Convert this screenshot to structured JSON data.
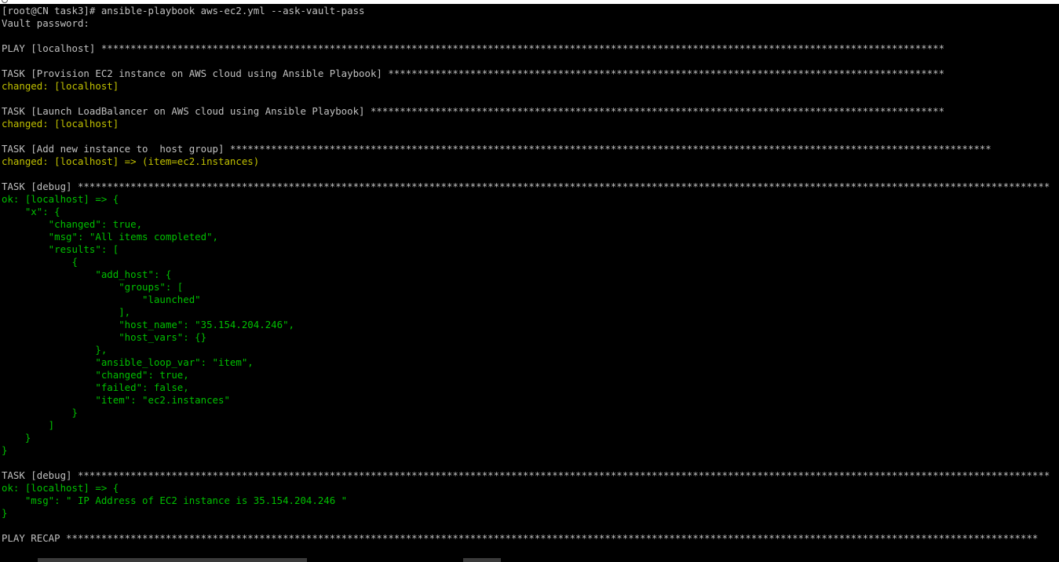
{
  "terminal": {
    "colors": {
      "background": "#000000",
      "default_text": "#c0c0c0",
      "changed": "#c0c000",
      "ok": "#00c000"
    },
    "lines": [
      {
        "text": "[root@CN task3]# ansible-playbook aws-ec2.yml --ask-vault-pass",
        "style": "default"
      },
      {
        "text": "Vault password:",
        "style": "default"
      },
      {
        "text": "",
        "style": "default"
      },
      {
        "text": "PLAY [localhost] ************************************************************************************************************************************************",
        "style": "default"
      },
      {
        "text": "",
        "style": "default"
      },
      {
        "text": "TASK [Provision EC2 instance on AWS cloud using Ansible Playbook] ***********************************************************************************************",
        "style": "default"
      },
      {
        "text": "changed: [localhost]",
        "style": "changed"
      },
      {
        "text": "",
        "style": "default"
      },
      {
        "text": "TASK [Launch LoadBalancer on AWS cloud using Ansible Playbook] **************************************************************************************************",
        "style": "default"
      },
      {
        "text": "changed: [localhost]",
        "style": "changed"
      },
      {
        "text": "",
        "style": "default"
      },
      {
        "text": "TASK [Add new instance to  host group] **********************************************************************************************************************************",
        "style": "default"
      },
      {
        "text": "changed: [localhost] => (item=ec2.instances)",
        "style": "changed"
      },
      {
        "text": "",
        "style": "default"
      },
      {
        "text": "TASK [debug] **********************************************************************************************************************************************************************",
        "style": "default"
      },
      {
        "text": "ok: [localhost] => {",
        "style": "ok"
      },
      {
        "text": "    \"x\": {",
        "style": "ok"
      },
      {
        "text": "        \"changed\": true,",
        "style": "ok"
      },
      {
        "text": "        \"msg\": \"All items completed\",",
        "style": "ok"
      },
      {
        "text": "        \"results\": [",
        "style": "ok"
      },
      {
        "text": "            {",
        "style": "ok"
      },
      {
        "text": "                \"add_host\": {",
        "style": "ok"
      },
      {
        "text": "                    \"groups\": [",
        "style": "ok"
      },
      {
        "text": "                        \"launched\"",
        "style": "ok"
      },
      {
        "text": "                    ],",
        "style": "ok"
      },
      {
        "text": "                    \"host_name\": \"35.154.204.246\",",
        "style": "ok"
      },
      {
        "text": "                    \"host_vars\": {}",
        "style": "ok"
      },
      {
        "text": "                },",
        "style": "ok"
      },
      {
        "text": "                \"ansible_loop_var\": \"item\",",
        "style": "ok"
      },
      {
        "text": "                \"changed\": true,",
        "style": "ok"
      },
      {
        "text": "                \"failed\": false,",
        "style": "ok"
      },
      {
        "text": "                \"item\": \"ec2.instances\"",
        "style": "ok"
      },
      {
        "text": "            }",
        "style": "ok"
      },
      {
        "text": "        ]",
        "style": "ok"
      },
      {
        "text": "    }",
        "style": "ok"
      },
      {
        "text": "}",
        "style": "ok"
      },
      {
        "text": "",
        "style": "default"
      },
      {
        "text": "TASK [debug] **********************************************************************************************************************************************************************",
        "style": "default"
      },
      {
        "text": "ok: [localhost] => {",
        "style": "ok"
      },
      {
        "text": "    \"msg\": \" IP Address of EC2 instance is 35.154.204.246 \"",
        "style": "ok"
      },
      {
        "text": "}",
        "style": "ok"
      },
      {
        "text": "",
        "style": "default"
      },
      {
        "text": "PLAY RECAP **********************************************************************************************************************************************************************",
        "style": "default"
      }
    ]
  }
}
